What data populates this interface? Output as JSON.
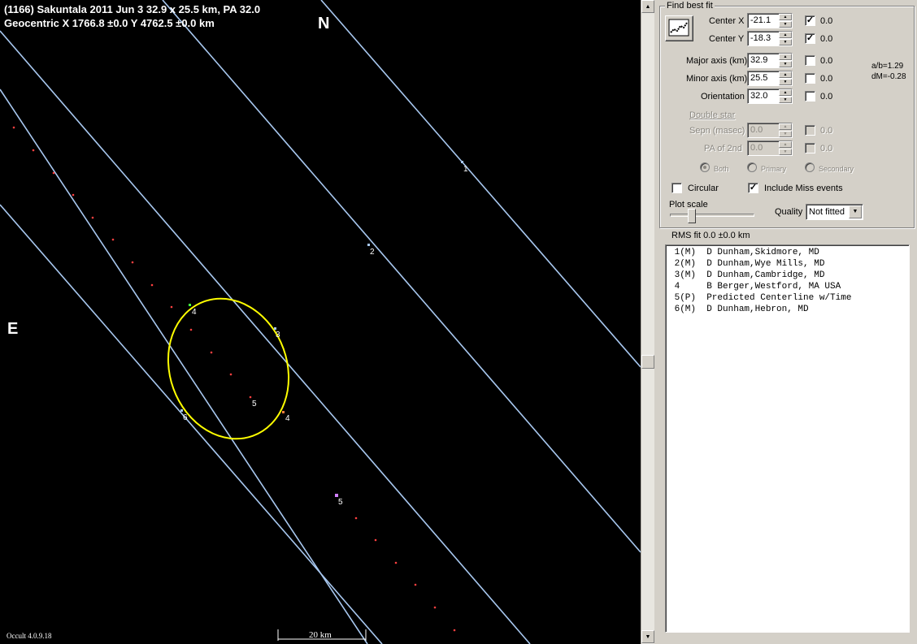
{
  "plot": {
    "title_line1": "(1166) Sakuntala  2011 Jun 3   32.9 x 25.5 km, PA 32.0",
    "title_line2": "Geocentric  X  1766.8 ±0.0  Y 4762.5 ±0.0 km",
    "north_label": "N",
    "east_label": "E",
    "version": "Occult 4.0.9.18",
    "scale_label": "20 km",
    "chord_labels": [
      "1",
      "2",
      "3",
      "4",
      "4",
      "5",
      "5",
      "6"
    ],
    "colors": {
      "background": "#000000",
      "chord": "#a8c8f0",
      "ellipse": "#ffff00",
      "prediction_dots": "#ff4040"
    }
  },
  "panel": {
    "group_title": "Find best fit",
    "fit_button_icon": "chart-fit-icon",
    "fields": [
      {
        "label": "Center X",
        "value": "-21.1",
        "checked": true,
        "uncertainty": "0.0"
      },
      {
        "label": "Center Y",
        "value": "-18.3",
        "checked": true,
        "uncertainty": "0.0"
      },
      {
        "label": "Major axis (km)",
        "value": "32.9",
        "checked": false,
        "uncertainty": "0.0"
      },
      {
        "label": "Minor axis (km)",
        "value": "25.5",
        "checked": false,
        "uncertainty": "0.0"
      },
      {
        "label": "Orientation",
        "value": "32.0",
        "checked": false,
        "uncertainty": "0.0"
      }
    ],
    "ratio_text": "a/b=1.29",
    "dm_text": "dM=-0.28",
    "double_star": {
      "heading": "Double star",
      "sepn_label": "Sepn (masec)",
      "sepn_value": "0.0",
      "sepn_unc": "0.0",
      "pa_label": "PA of 2nd",
      "pa_value": "0.0",
      "pa_unc": "0.0",
      "radio_both": "Both",
      "radio_primary": "Primary",
      "radio_secondary": "Secondary"
    },
    "circular_label": "Circular",
    "circular_checked": false,
    "include_miss_label": "Include Miss events",
    "include_miss_checked": true,
    "plot_scale_label": "Plot scale",
    "plot_scale_level": 0.25,
    "quality_label": "Quality",
    "quality_value": "Not fitted",
    "rms_text": "RMS fit  0.0 ±0.0 km",
    "observers": [
      " 1(M)  D Dunham,Skidmore, MD",
      " 2(M)  D Dunham,Wye Mills, MD",
      " 3(M)  D Dunham,Cambridge, MD",
      " 4     B Berger,Westford, MA USA",
      " 5(P)  Predicted Centerline w/Time",
      " 6(M)  D Dunham,Hebron, MD"
    ]
  }
}
